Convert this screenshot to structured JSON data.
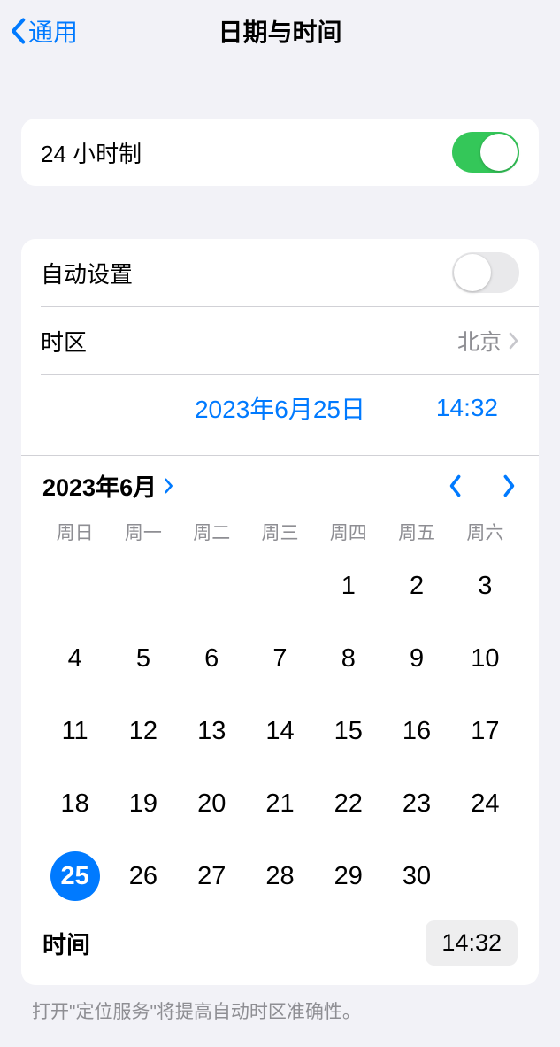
{
  "header": {
    "back": "通用",
    "title": "日期与时间"
  },
  "clock24": {
    "label": "24 小时制",
    "on": true
  },
  "autoset": {
    "label": "自动设置",
    "on": false
  },
  "timezone": {
    "label": "时区",
    "value": "北京"
  },
  "datetime": {
    "date": "2023年6月25日",
    "time": "14:32"
  },
  "calendar": {
    "month": "2023年6月",
    "weekdays": [
      "周日",
      "周一",
      "周二",
      "周三",
      "周四",
      "周五",
      "周六"
    ],
    "startOffset": 4,
    "daysInMonth": 30,
    "selected": 25,
    "timeLabel": "时间",
    "timeValue": "14:32"
  },
  "footer": "打开\"定位服务\"将提高自动时区准确性。"
}
